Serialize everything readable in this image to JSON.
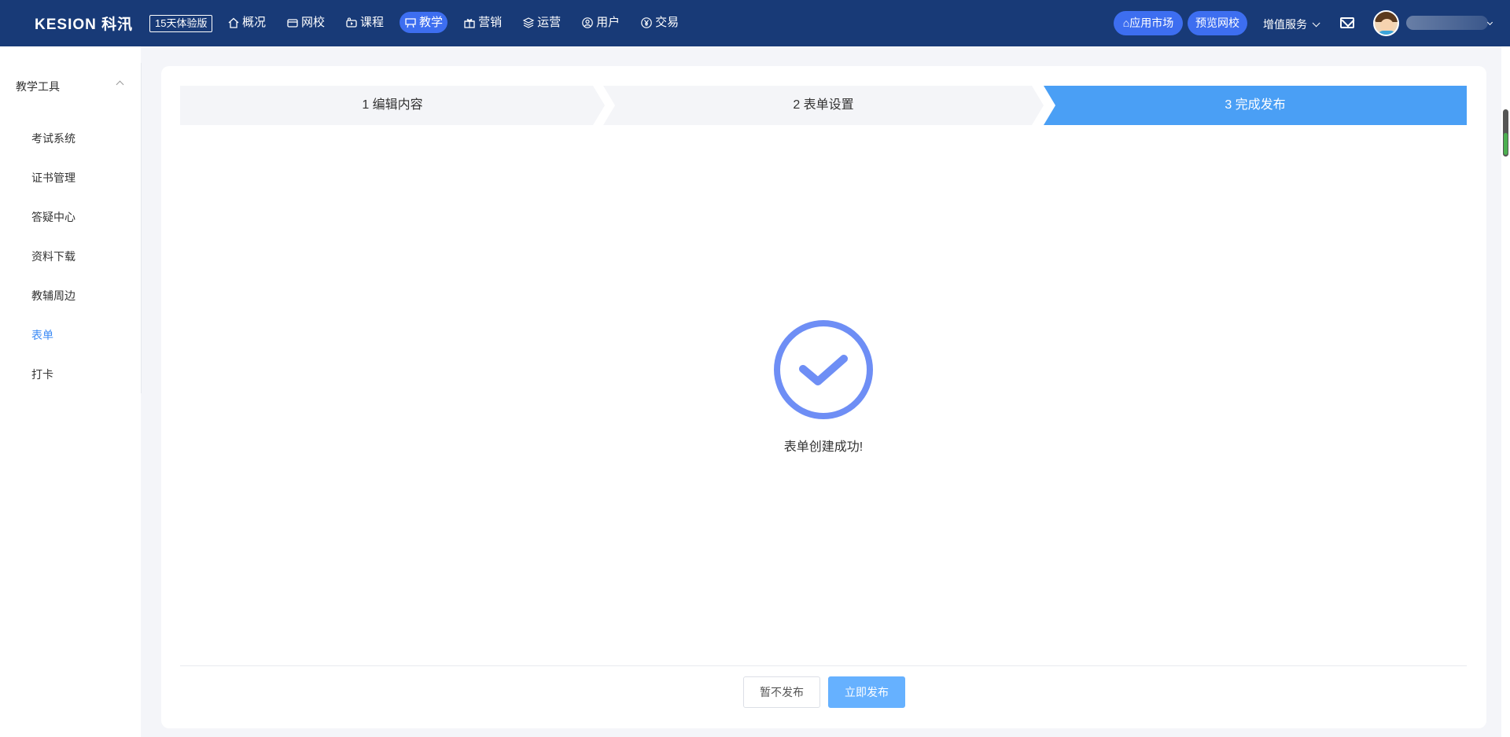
{
  "header": {
    "logo_text": "KESION 科汛",
    "trial_badge": "15天体验版",
    "nav": [
      {
        "label": "概况",
        "icon": "home-icon"
      },
      {
        "label": "网校",
        "icon": "school-icon"
      },
      {
        "label": "课程",
        "icon": "course-icon"
      },
      {
        "label": "教学",
        "icon": "teach-icon",
        "active": true
      },
      {
        "label": "营销",
        "icon": "gift-icon"
      },
      {
        "label": "运营",
        "icon": "layers-icon"
      },
      {
        "label": "用户",
        "icon": "user-icon"
      },
      {
        "label": "交易",
        "icon": "yen-icon"
      }
    ],
    "app_market": "应用市场",
    "preview_school": "预览网校",
    "value_services": "增值服务"
  },
  "sidebar": {
    "group_title": "教学工具",
    "items": [
      {
        "label": "考试系统"
      },
      {
        "label": "证书管理"
      },
      {
        "label": "答疑中心"
      },
      {
        "label": "资料下载"
      },
      {
        "label": "教辅周边"
      },
      {
        "label": "表单",
        "active": true
      },
      {
        "label": "打卡"
      }
    ]
  },
  "steps": [
    {
      "label": "1 编辑内容"
    },
    {
      "label": "2 表单设置"
    },
    {
      "label": "3 完成发布"
    }
  ],
  "result": {
    "message": "表单创建成功!"
  },
  "actions": {
    "later": "暂不发布",
    "publish": "立即发布"
  },
  "colors": {
    "topbar": "#183a77",
    "accent": "#3d6ef0",
    "step_active": "#4a9ff5",
    "success_icon": "#6e8ef5",
    "primary_button": "#66b1ff"
  }
}
